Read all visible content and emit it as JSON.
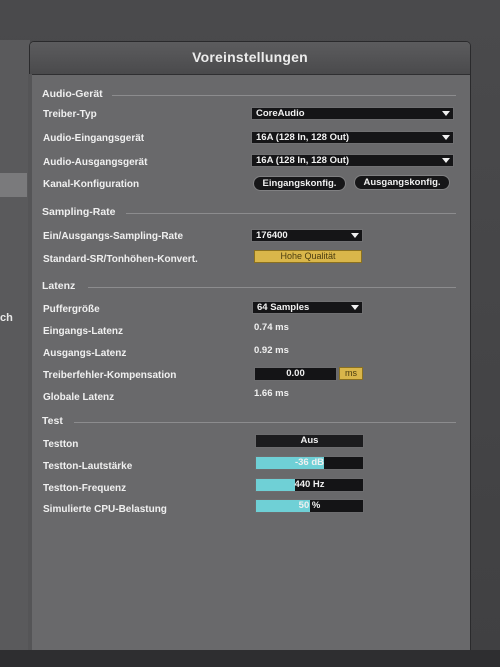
{
  "window": {
    "title": "Voreinstellungen"
  },
  "left_fragment": "ch",
  "sections": {
    "audio_device": {
      "title": "Audio-Gerät",
      "driver_type": {
        "label": "Treiber-Typ",
        "value": "CoreAudio"
      },
      "input_device": {
        "label": "Audio-Eingangsgerät",
        "value": "16A (128 In, 128 Out)"
      },
      "output_device": {
        "label": "Audio-Ausgangsgerät",
        "value": "16A (128 In, 128 Out)"
      },
      "channel_config": {
        "label": "Kanal-Konfiguration",
        "input_button": "Eingangskonfig.",
        "output_button": "Ausgangskonfig."
      }
    },
    "sample_rate": {
      "title": "Sampling-Rate",
      "io_rate": {
        "label": "Ein/Ausgangs-Sampling-Rate",
        "value": "176400"
      },
      "default_sr": {
        "label": "Standard-SR/Tonhöhen-Konvert.",
        "value": "Hohe Qualität"
      }
    },
    "latency": {
      "title": "Latenz",
      "buffer_size": {
        "label": "Puffergröße",
        "value": "64 Samples"
      },
      "input_latency": {
        "label": "Eingangs-Latenz",
        "value": "0.74 ms"
      },
      "output_latency": {
        "label": "Ausgangs-Latenz",
        "value": "0.92 ms"
      },
      "driver_error_comp": {
        "label": "Treiberfehler-Kompensation",
        "value": "0.00",
        "unit": "ms"
      },
      "global_latency": {
        "label": "Globale Latenz",
        "value": "1.66 ms"
      }
    },
    "test": {
      "title": "Test",
      "test_tone": {
        "label": "Testton",
        "value": "Aus"
      },
      "tone_volume": {
        "label": "Testton-Lautstärke",
        "value": "-36 dB",
        "fill": 0.64
      },
      "tone_frequency": {
        "label": "Testton-Frequenz",
        "value": "440 Hz",
        "fill": 0.36
      },
      "cpu_load": {
        "label": "Simulierte CPU-Belastung",
        "value": "50 %",
        "fill": 0.5
      }
    }
  },
  "colors": {
    "accent_yellow": "#d9b64a",
    "slider_cyan": "#6fd0d6",
    "panel_gray": "#69696b"
  }
}
